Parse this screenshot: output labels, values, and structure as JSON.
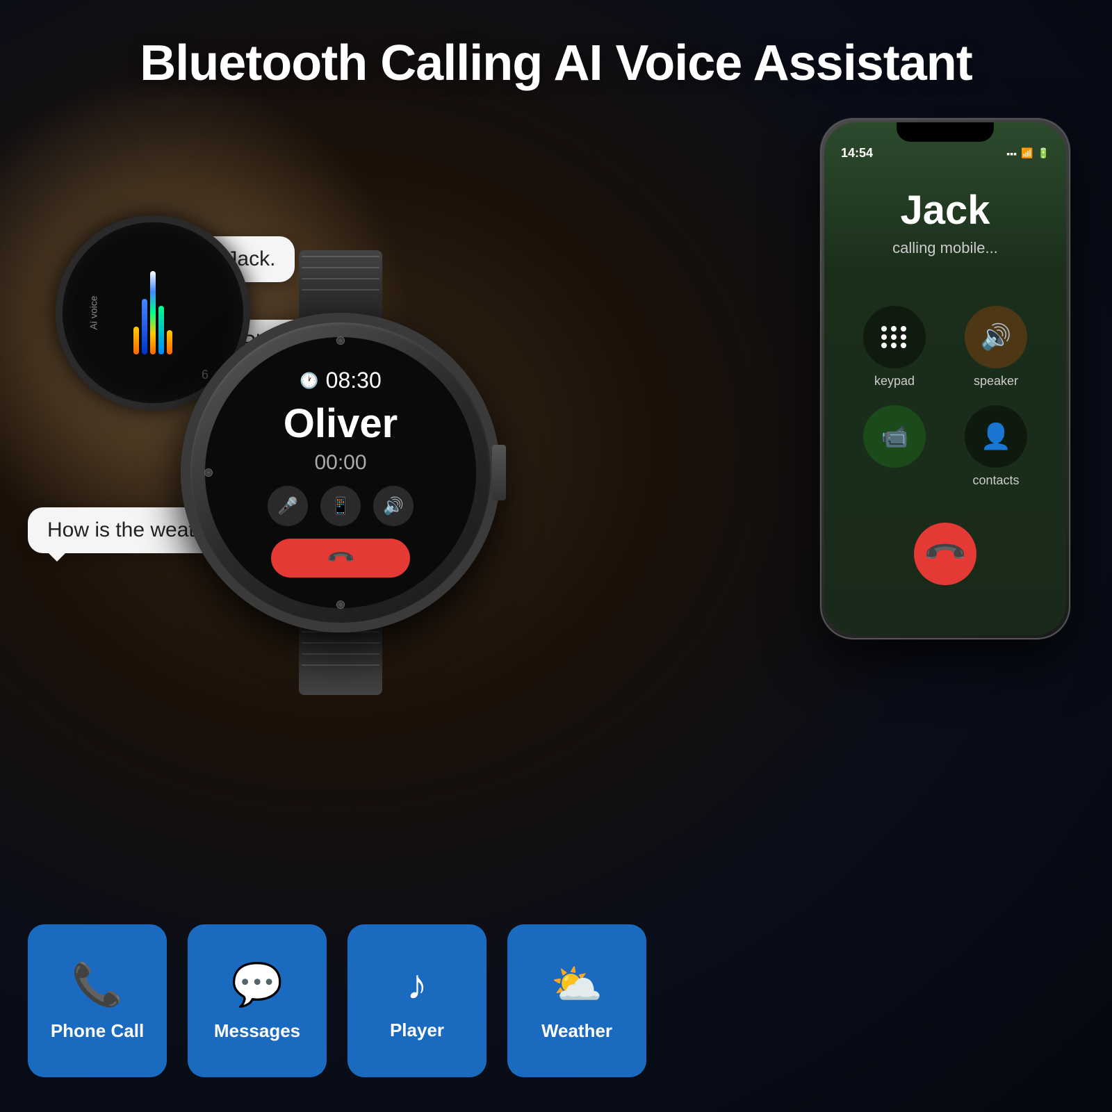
{
  "page": {
    "title": "Bluetooth Calling AI Voice Assistant",
    "bg_color": "#0a1628"
  },
  "speech_bubbles": {
    "bubble1": "Please call Jack.",
    "bubble2": "Play music.",
    "bubble3": "How is the weather today?"
  },
  "watch_small": {
    "label": "Ai voice",
    "number": "6"
  },
  "watch_large": {
    "time": "08:30",
    "caller": "Oliver",
    "duration": "00:00"
  },
  "phone": {
    "time": "14:54",
    "caller_name": "Jack",
    "caller_status": "calling mobile...",
    "controls": [
      {
        "label": "keypad",
        "icon": "⠿"
      },
      {
        "label": "speaker",
        "icon": "🔊"
      },
      {
        "label": "",
        "icon": "📹"
      },
      {
        "label": "contacts",
        "icon": "👤"
      }
    ]
  },
  "features": [
    {
      "label": "Phone Call",
      "icon": "📞"
    },
    {
      "label": "Messages",
      "icon": "💬"
    },
    {
      "label": "Player",
      "icon": "♪"
    },
    {
      "label": "Weather",
      "icon": "⛅"
    }
  ],
  "icons": {
    "phone": "📞",
    "message": "💬",
    "music": "♪",
    "weather": "⛅",
    "mic": "🎤",
    "phone_white": "📱",
    "volume": "🔊",
    "end_call": "📞",
    "keypad": "⠿",
    "contact": "👤",
    "video": "📹",
    "clock": "🕐"
  }
}
